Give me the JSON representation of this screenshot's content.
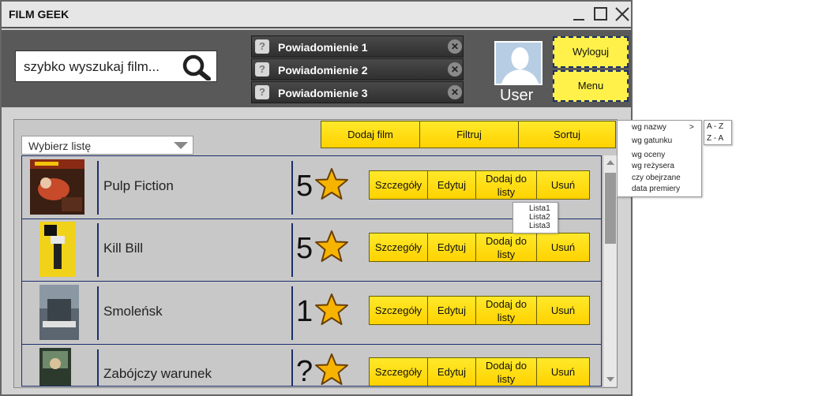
{
  "app": {
    "title": "FILM GEEK"
  },
  "search": {
    "placeholder": "szybko wyszukaj film..."
  },
  "notifications": [
    {
      "label": "Powiadomienie 1"
    },
    {
      "label": "Powiadomienie 2"
    },
    {
      "label": "Powiadomienie 3"
    }
  ],
  "user": {
    "name": "User",
    "logout_label": "Wyloguj",
    "menu_label": "Menu"
  },
  "list_select": {
    "value": "Wybierz listę"
  },
  "toolbar": {
    "add_label": "Dodaj film",
    "filter_label": "Filtruj",
    "sort_label": "Sortuj"
  },
  "actions": {
    "details": "Szczegóły",
    "edit": "Edytuj",
    "add_to_list": "Dodaj do listy",
    "delete": "Usuń"
  },
  "movies": [
    {
      "title": "Pulp Fiction",
      "rating": "5"
    },
    {
      "title": "Kill Bill",
      "rating": "5"
    },
    {
      "title": "Smoleńsk",
      "rating": "1"
    },
    {
      "title": "Zabójczy warunek",
      "rating": "?"
    }
  ],
  "list_popup": {
    "items": [
      "Lista1",
      "Lista2",
      "Lista3"
    ]
  },
  "sort_menu": {
    "items": [
      "wg nazwy",
      "wg gatunku",
      "wg oceny",
      "wg reżysera",
      "czy obejrzane",
      "data premiery"
    ],
    "submenu_arrow": ">",
    "submenu": [
      "A - Z",
      "Z - A"
    ]
  },
  "colors": {
    "accent": "#ffe92a",
    "header": "#595959",
    "border_blue": "#1b2f6b"
  }
}
